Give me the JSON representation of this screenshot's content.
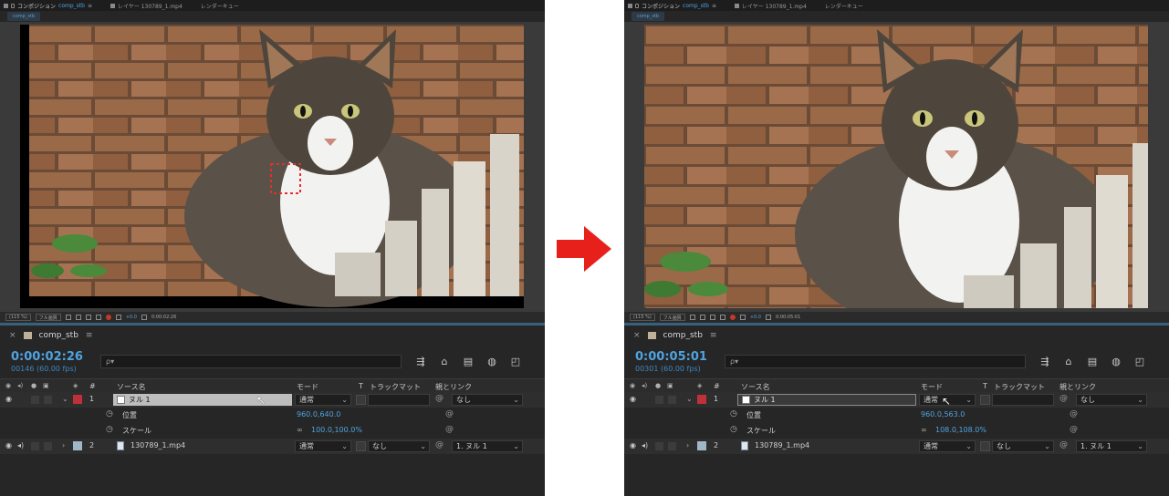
{
  "tabs": {
    "composition_label": "コンポジション",
    "composition_name": "comp_stb",
    "layer_label": "レイヤー 130789_1.mp4",
    "render_queue_label": "レンダーキュー",
    "subtab_label": "comp_stb"
  },
  "viewer_toolbar": {
    "zoom": "(115 %)",
    "resolution": "フル画質",
    "exposure": "+0.0"
  },
  "arrow_color": "#e8201c",
  "left": {
    "viewer_timecode": "0:00:02:26",
    "timeline": {
      "comp_name": "comp_stb",
      "timecode": "0:00:02:26",
      "frames": "00146 (60.00 fps)",
      "search_placeholder": "ρ▾",
      "columns": {
        "source_name": "ソース名",
        "mode": "モード",
        "t": "T",
        "trackmatte": "トラックマット",
        "parent": "親とリンク",
        "hash": "#"
      },
      "layer1": {
        "index": "1",
        "name": "ヌル 1",
        "mode": "通常",
        "parent": "なし"
      },
      "position": {
        "label": "位置",
        "value": "960.0,640.0"
      },
      "scale": {
        "label": "スケール",
        "value": "100.0,100.0%"
      },
      "layer2": {
        "index": "2",
        "name": "130789_1.mp4",
        "mode": "通常",
        "trackmatte": "なし",
        "parent": "1. ヌル 1"
      }
    }
  },
  "right": {
    "viewer_timecode": "0:00:05:01",
    "timeline": {
      "comp_name": "comp_stb",
      "timecode": "0:00:05:01",
      "frames": "00301 (60.00 fps)",
      "search_placeholder": "ρ▾",
      "columns": {
        "source_name": "ソース名",
        "mode": "モード",
        "t": "T",
        "trackmatte": "トラックマット",
        "parent": "親とリンク",
        "hash": "#"
      },
      "layer1": {
        "index": "1",
        "name": "ヌル 1",
        "mode": "通常",
        "parent": "なし"
      },
      "position": {
        "label": "位置",
        "value": "960.0,563.0"
      },
      "scale": {
        "label": "スケール",
        "value": "108.0,108.0%"
      },
      "layer2": {
        "index": "2",
        "name": "130789_1.mp4",
        "mode": "通常",
        "trackmatte": "なし",
        "parent": "1. ヌル 1"
      }
    }
  }
}
